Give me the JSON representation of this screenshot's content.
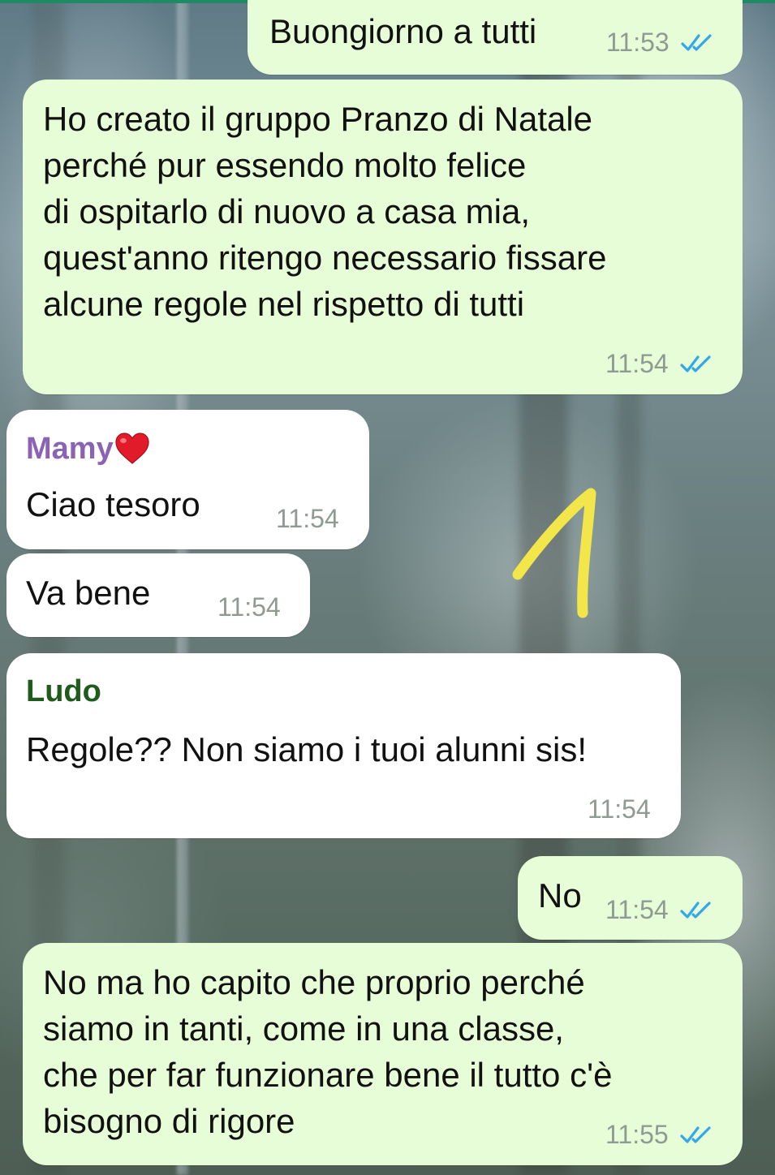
{
  "chat": {
    "messages": [
      {
        "direction": "outgoing",
        "text": "Buongiorno a tutti",
        "time": "11:53",
        "status": "read"
      },
      {
        "direction": "outgoing",
        "text": "Ho creato il gruppo Pranzo di Natale\nperché pur essendo molto felice\ndi ospitarlo di nuovo a casa mia,\nquest'anno ritengo necessario fissare\nalcune regole nel rispetto di tutti",
        "time": "11:54",
        "status": "read"
      },
      {
        "direction": "incoming",
        "sender": "Mamy",
        "text": "Ciao tesoro",
        "time": "11:54"
      },
      {
        "direction": "incoming",
        "text": "Va bene",
        "time": "11:54"
      },
      {
        "direction": "incoming",
        "sender": "Ludo",
        "text": "Regole?? Non siamo i tuoi alunni sis!",
        "time": "11:54"
      },
      {
        "direction": "outgoing",
        "text": "No",
        "time": "11:54",
        "status": "read"
      },
      {
        "direction": "outgoing",
        "text": "No ma ho capito che proprio perché\nsiamo in tanti, come in una classe,\nche per far funzionare bene il tutto c'è\nbisogno di rigore",
        "time": "11:55",
        "status": "read"
      }
    ]
  },
  "annotation": {
    "text": "1",
    "color": "#f2e64b"
  },
  "colors": {
    "outgoing_bubble": "#e7fdd8",
    "incoming_bubble": "#ffffff",
    "read_ticks": "#34a7e8",
    "sender_mamy": "#8b63b5",
    "sender_ludo": "#1f5c1c",
    "timestamp": "#8e9a92"
  },
  "icons": [
    "double-check-icon",
    "red-heart-icon"
  ]
}
